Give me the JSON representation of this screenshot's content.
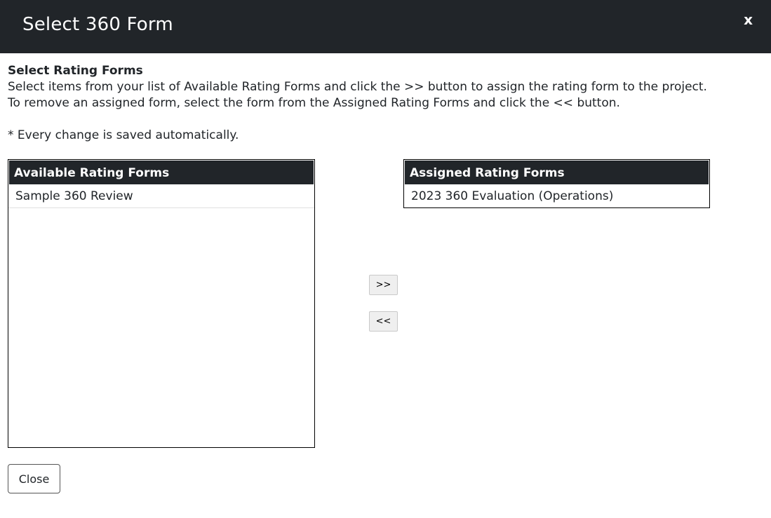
{
  "dialog": {
    "title": "Select 360 Form",
    "close_icon_label": "x"
  },
  "instructions": {
    "heading": "Select Rating Forms",
    "line1": "Select items from your list of Available Rating Forms and click the >> button to assign the rating form to the project.",
    "line2": "To remove an assigned form, select the form from the Assigned Rating Forms and click the << button.",
    "note": "* Every change is saved automatically."
  },
  "available": {
    "header": "Available Rating Forms",
    "items": [
      "Sample 360 Review"
    ]
  },
  "assigned": {
    "header": "Assigned Rating Forms",
    "items": [
      "2023 360 Evaluation (Operations)"
    ]
  },
  "buttons": {
    "assign_label": ">>",
    "remove_label": "<<",
    "close_label": "Close"
  },
  "colors": {
    "header_bg": "#212529",
    "header_text": "#ffffff"
  }
}
